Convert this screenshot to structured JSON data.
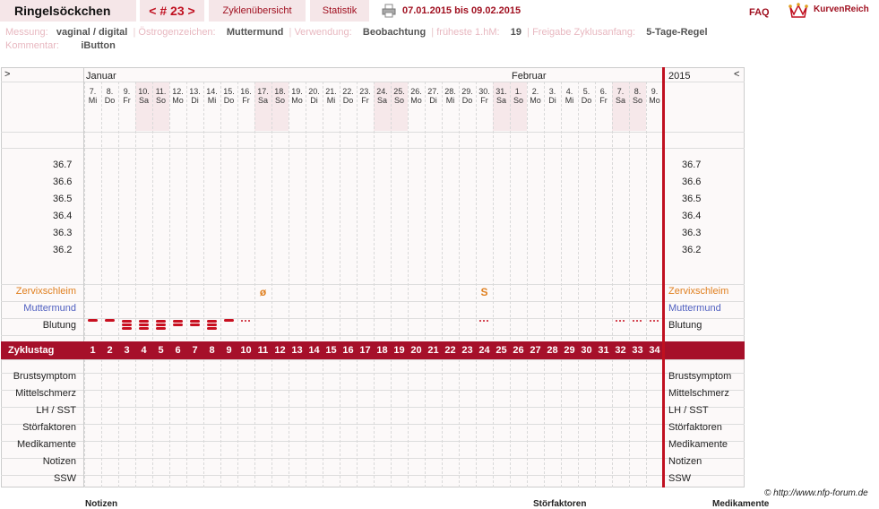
{
  "header": {
    "title": "Ringelsöckchen",
    "cycle_nav": "< # 23 >",
    "tab_overview": "Zyklenübersicht",
    "tab_stats": "Statistik",
    "date_range": "07.01.2015 bis 09.02.2015",
    "faq": "FAQ",
    "logo": "KurvenReich"
  },
  "info": {
    "messung_label": "Messung:",
    "messung_value": "vaginal / digital",
    "oestrogen_label": "Östrogenzeichen:",
    "oestrogen_value": "Muttermund",
    "verwendung_label": "Verwendung:",
    "verwendung_value": "Beobachtung",
    "fruehest_label": "früheste 1.hM:",
    "fruehest_value": "19",
    "freigabe_label": "Freigabe Zyklusanfang:",
    "freigabe_value": "5-Tage-Regel",
    "kommentar_label": "Kommentar:",
    "kommentar_value": "iButton"
  },
  "chart": {
    "left_arrow": ">",
    "right_arrow": "<",
    "month1": "Januar",
    "month2": "Februar",
    "year": "2015",
    "days": [
      {
        "d": "7.",
        "w": "Mi"
      },
      {
        "d": "8.",
        "w": "Do"
      },
      {
        "d": "9.",
        "w": "Fr"
      },
      {
        "d": "10.",
        "w": "Sa"
      },
      {
        "d": "11.",
        "w": "So"
      },
      {
        "d": "12.",
        "w": "Mo"
      },
      {
        "d": "13.",
        "w": "Di"
      },
      {
        "d": "14.",
        "w": "Mi"
      },
      {
        "d": "15.",
        "w": "Do"
      },
      {
        "d": "16.",
        "w": "Fr"
      },
      {
        "d": "17.",
        "w": "Sa"
      },
      {
        "d": "18.",
        "w": "So"
      },
      {
        "d": "19.",
        "w": "Mo"
      },
      {
        "d": "20.",
        "w": "Di"
      },
      {
        "d": "21.",
        "w": "Mi"
      },
      {
        "d": "22.",
        "w": "Do"
      },
      {
        "d": "23.",
        "w": "Fr"
      },
      {
        "d": "24.",
        "w": "Sa"
      },
      {
        "d": "25.",
        "w": "So"
      },
      {
        "d": "26.",
        "w": "Mo"
      },
      {
        "d": "27.",
        "w": "Di"
      },
      {
        "d": "28.",
        "w": "Mi"
      },
      {
        "d": "29.",
        "w": "Do"
      },
      {
        "d": "30.",
        "w": "Fr"
      },
      {
        "d": "31.",
        "w": "Sa"
      },
      {
        "d": "1.",
        "w": "So"
      },
      {
        "d": "2.",
        "w": "Mo"
      },
      {
        "d": "3.",
        "w": "Di"
      },
      {
        "d": "4.",
        "w": "Mi"
      },
      {
        "d": "5.",
        "w": "Do"
      },
      {
        "d": "6.",
        "w": "Fr"
      },
      {
        "d": "7.",
        "w": "Sa"
      },
      {
        "d": "8.",
        "w": "So"
      },
      {
        "d": "9.",
        "w": "Mo"
      }
    ],
    "temps": [
      "36.7",
      "36.6",
      "36.5",
      "36.4",
      "36.3",
      "36.2"
    ],
    "zervix_label": "Zervixschleim",
    "mutter_label": "Muttermund",
    "blutung_label": "Blutung",
    "zyklustag_label": "Zyklustag",
    "zervix_marks": [
      {
        "day": 11,
        "sym": "ø"
      },
      {
        "day": 24,
        "sym": "S"
      }
    ],
    "bleeding": [
      1,
      1,
      3,
      3,
      3,
      2,
      2,
      3,
      1,
      "s",
      "",
      "",
      "",
      "",
      "",
      "",
      "",
      "",
      "",
      "",
      "",
      "",
      "",
      "s",
      "",
      "",
      "",
      "",
      "",
      "",
      "",
      "s",
      "s",
      "s"
    ],
    "bottom_rows": [
      "Brustsymptom",
      "Mittelschmerz",
      "LH / SST",
      "Störfaktoren",
      "Medikamente",
      "Notizen",
      "SSW"
    ]
  },
  "footer": {
    "copyright": "© http://www.nfp-forum.de",
    "col1": "Notizen",
    "col2": "Störfaktoren",
    "col3": "Medikamente"
  },
  "colors": {
    "accent": "#a6102a",
    "zervix": "#e08020",
    "muttermund": "#5060c0"
  }
}
